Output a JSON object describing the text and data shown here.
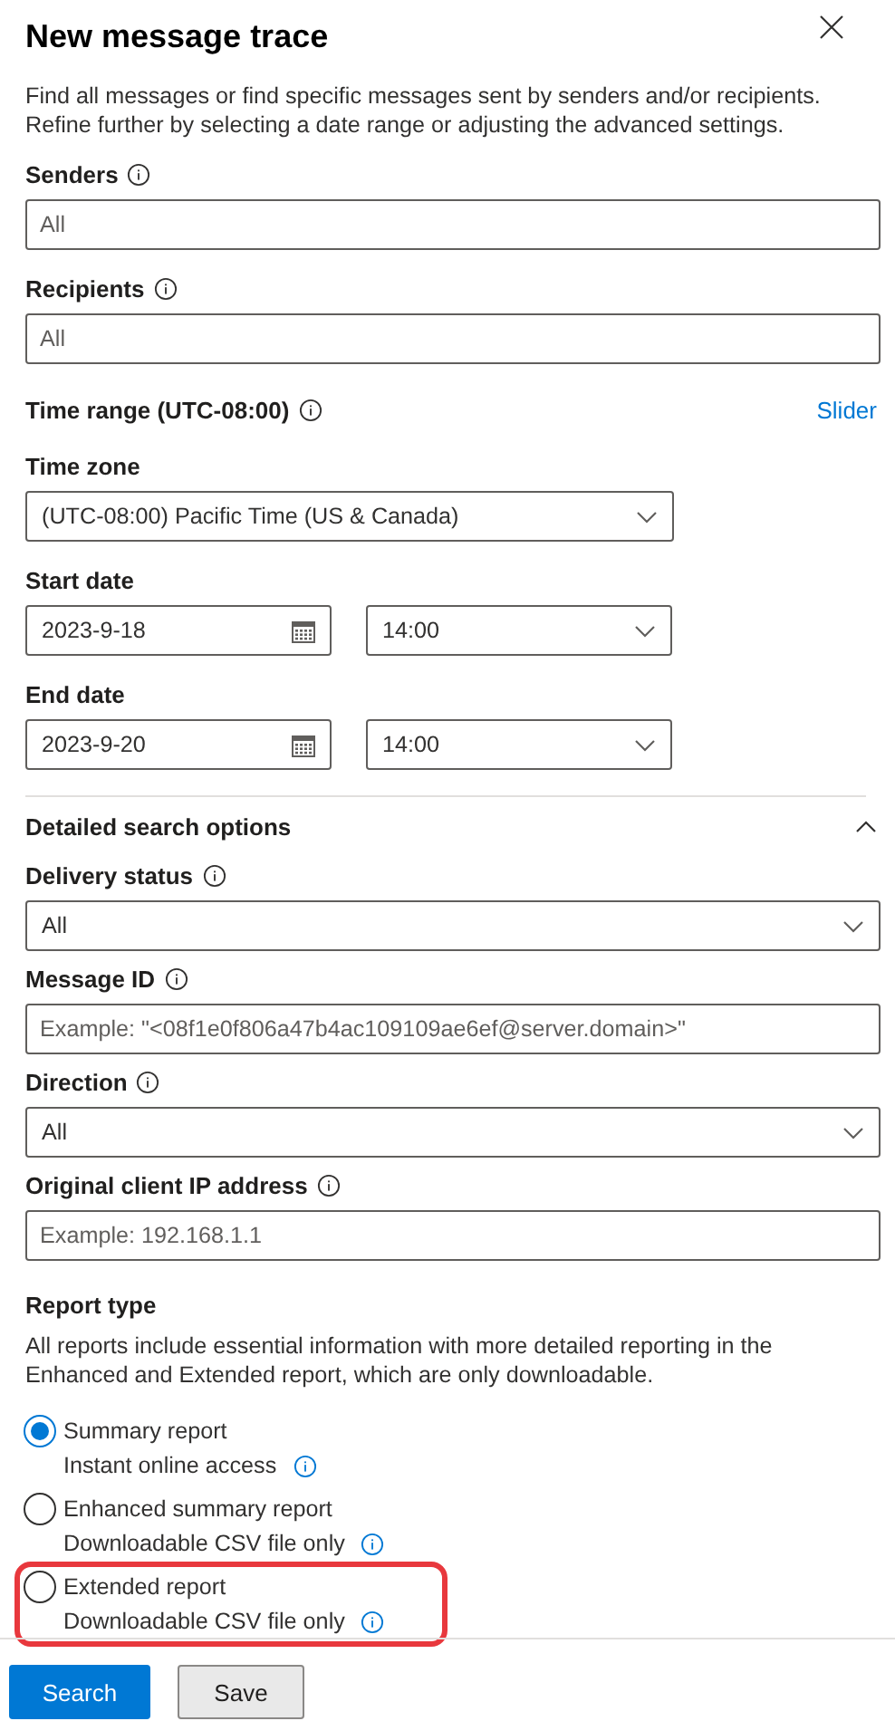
{
  "title": "New message trace",
  "description": "Find all messages or find specific messages sent by senders and/or recipients. Refine further by selecting a date range or adjusting the advanced settings.",
  "recipients_fields": [
    {
      "kind": "text",
      "label": "Senders",
      "info": true,
      "placeholder": "All"
    },
    {
      "kind": "text",
      "label": "Recipients",
      "info": true,
      "placeholder": "All"
    }
  ],
  "time_range": {
    "label": "Time range (UTC-08:00)",
    "info": true,
    "link": "Slider"
  },
  "time_zone": {
    "label": "Time zone",
    "value": "(UTC-08:00) Pacific Time (US & Canada)"
  },
  "dates": [
    {
      "label": "Start date",
      "date": "2023-9-18",
      "time": "14:00"
    },
    {
      "label": "End date",
      "date": "2023-9-20",
      "time": "14:00"
    }
  ],
  "detailed": {
    "title": "Detailed search options",
    "expanded": true,
    "fields": [
      {
        "kind": "select",
        "label": "Delivery status",
        "info": true,
        "value": "All"
      },
      {
        "kind": "text",
        "label": "Message ID",
        "info": true,
        "placeholder": "Example: \"<08f1e0f806a47b4ac109109ae6ef@server.domain>\""
      },
      {
        "kind": "select",
        "label": "Direction",
        "info": true,
        "value": "All"
      },
      {
        "kind": "text",
        "label": "Original client IP address",
        "info": true,
        "placeholder": "Example: 192.168.1.1"
      }
    ]
  },
  "report_type": {
    "label": "Report type",
    "description": "All reports include essential information with more detailed reporting in the Enhanced and Extended report, which are only downloadable.",
    "options": [
      {
        "label": "Summary report",
        "sub": "Instant online access",
        "selected": true,
        "highlighted": false
      },
      {
        "label": "Enhanced summary report",
        "sub": "Downloadable CSV file only",
        "selected": false,
        "highlighted": false
      },
      {
        "label": "Extended report",
        "sub": "Downloadable CSV file only",
        "selected": false,
        "highlighted": true
      }
    ]
  },
  "buttons": [
    {
      "label": "Search",
      "kind": "primary"
    },
    {
      "label": "Save",
      "kind": "default"
    }
  ]
}
